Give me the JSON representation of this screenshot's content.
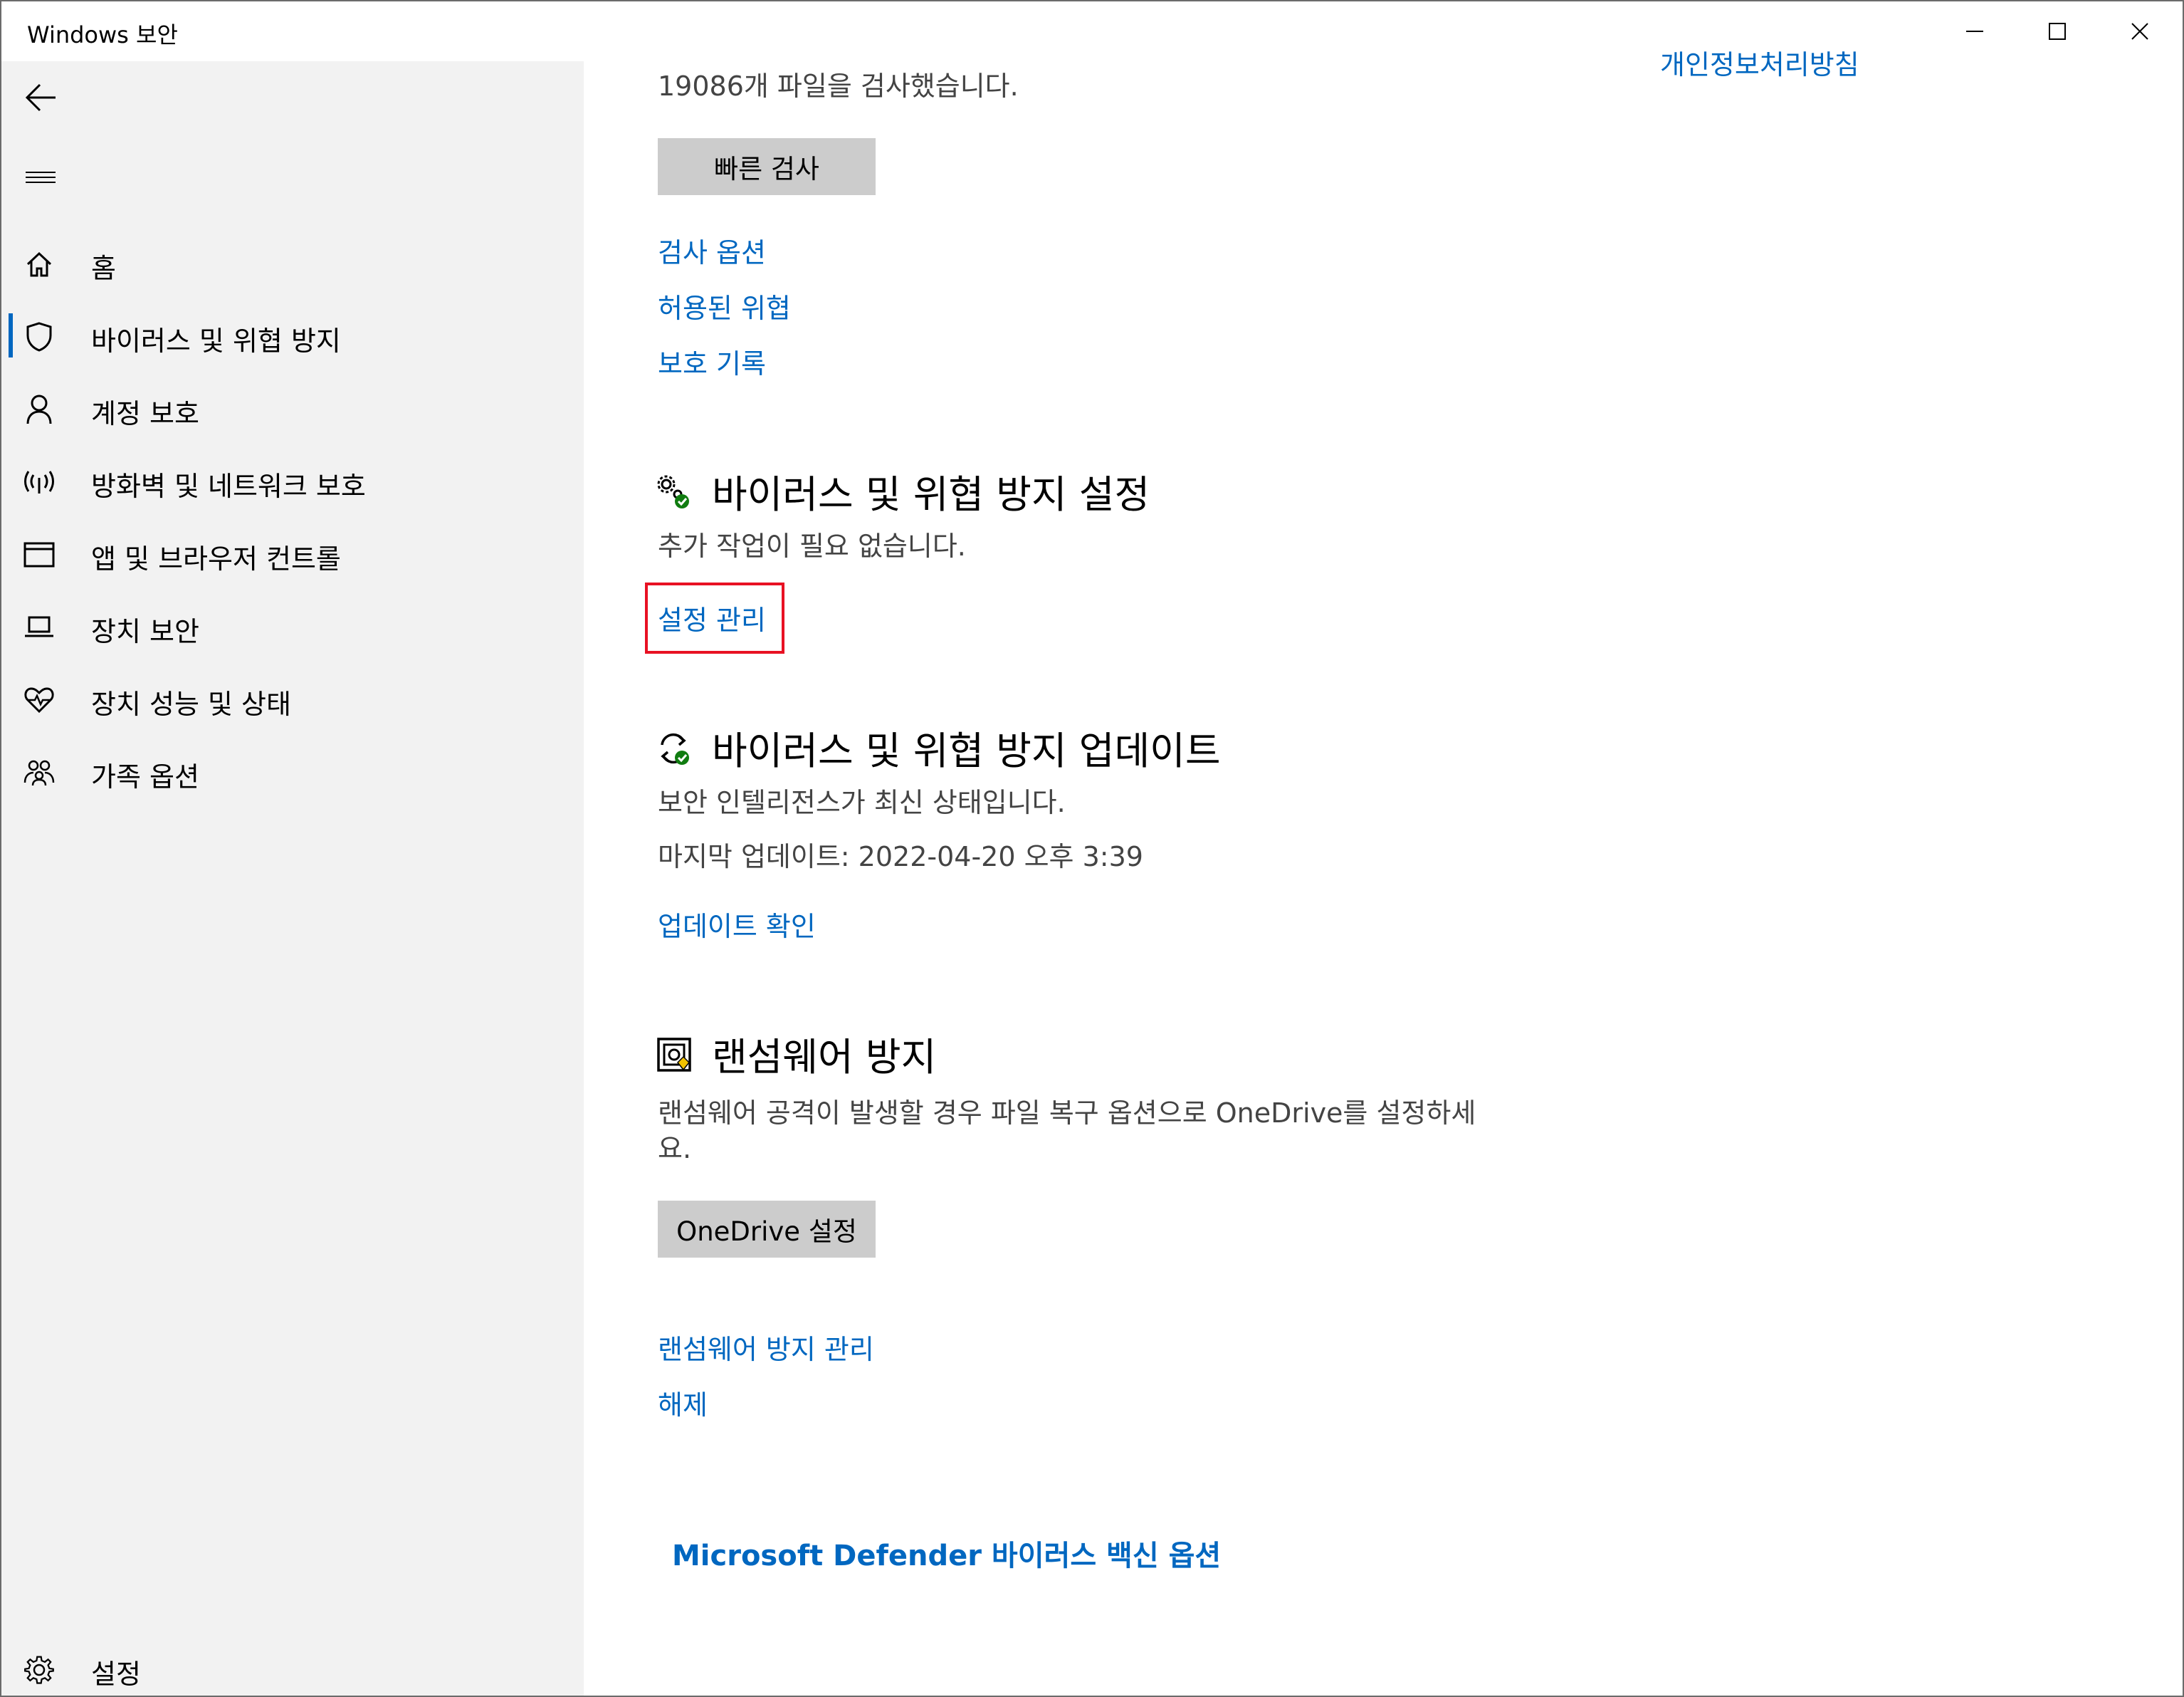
{
  "window": {
    "title": "Windows 보안"
  },
  "sidebar": {
    "items": [
      {
        "label": "홈",
        "icon": "home-icon"
      },
      {
        "label": "바이러스 및 위협 방지",
        "icon": "shield-icon",
        "selected": true
      },
      {
        "label": "계정 보호",
        "icon": "person-icon"
      },
      {
        "label": "방화벽 및 네트워크 보호",
        "icon": "wifi-broadcast-icon"
      },
      {
        "label": "앱 및 브라우저 컨트롤",
        "icon": "browser-window-icon"
      },
      {
        "label": "장치 보안",
        "icon": "laptop-icon"
      },
      {
        "label": "장치 성능 및 상태",
        "icon": "heart-pulse-icon"
      },
      {
        "label": "가족 옵션",
        "icon": "family-icon"
      }
    ],
    "settings_label": "설정"
  },
  "main": {
    "top_right_link": "개인정보처리방침",
    "scan_status": "19086개 파일을 검사했습니다.",
    "quick_scan_button": "빠른 검사",
    "links": {
      "scan_options": "검사 옵션",
      "allowed_threats": "허용된 위협",
      "protection_history": "보호 기록"
    },
    "settings_section": {
      "title": "바이러스 및 위협 방지 설정",
      "status": "추가 작업이 필요 없습니다.",
      "manage_link": "설정 관리"
    },
    "update_section": {
      "title": "바이러스 및 위협 방지 업데이트",
      "status": "보안 인텔리전스가 최신 상태입니다.",
      "last_update": "마지막 업데이트: 2022-04-20 오후 3:39",
      "check_link": "업데이트 확인"
    },
    "ransomware_section": {
      "title": "랜섬웨어 방지",
      "description_line1": "랜섬웨어 공격이 발생할 경우 파일 복구 옵션으로 OneDrive를 설정하세",
      "description_line2": "요.",
      "onedrive_button": "OneDrive 설정",
      "manage_link": "랜섬웨어 방지 관리",
      "dismiss_link": "해제"
    },
    "defender_options_link": "Microsoft Defender 바이러스 백신 옵션"
  },
  "colors": {
    "accent": "#0067c0",
    "sidebar_bg": "#f2f2f2",
    "button_bg": "#cccccc",
    "highlight": "#e81123",
    "status_green": "#107c10"
  }
}
